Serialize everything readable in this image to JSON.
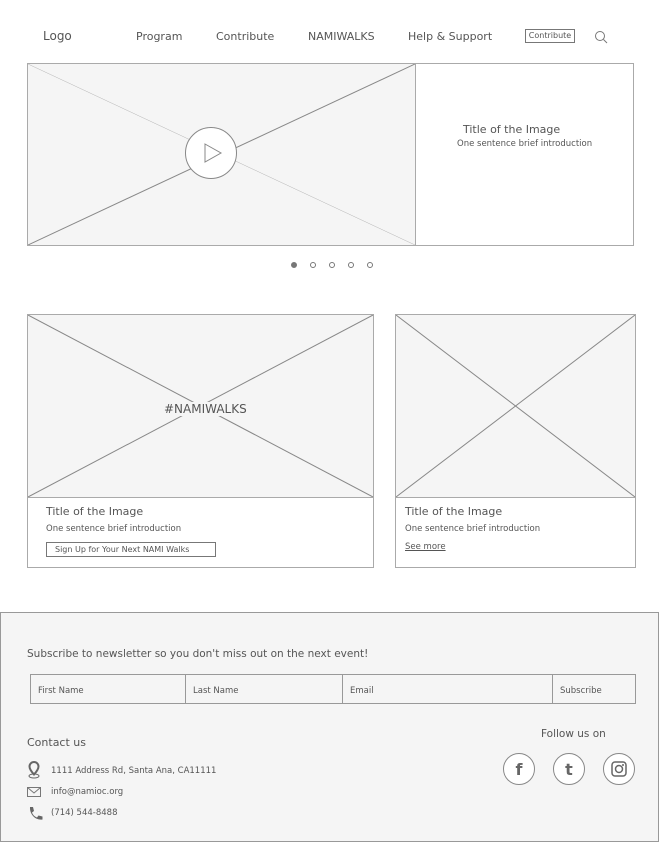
{
  "nav": {
    "logo": "Logo",
    "items": [
      "Program",
      "Contribute",
      "NAMIWALKS",
      "Help & Support"
    ],
    "cta": "Contribute"
  },
  "hero": {
    "title": "Title of the Image",
    "intro": "One sentence brief introduction",
    "slides": 5,
    "active_slide": 1
  },
  "cards": [
    {
      "overlay": "#NAMIWALKS",
      "title": "Title of the Image",
      "intro": "One sentence brief introduction",
      "button": "Sign Up for Your Next NAMI Walks"
    },
    {
      "title": "Title of the Image",
      "intro": "One sentence brief introduction",
      "link": "See more"
    }
  ],
  "footer": {
    "subscribe_text": "Subscribe to newsletter so you don't miss out on the next event!",
    "fields": {
      "first": "First Name",
      "last": "Last Name",
      "email": "Email"
    },
    "subscribe_button": "Subscribe",
    "contact_title": "Contact us",
    "address": "1111 Address Rd, Santa Ana, CA11111",
    "email": "info@namioc.org",
    "phone": "(714) 544-8488",
    "follow": "Follow us on",
    "social": {
      "facebook": "f",
      "tumblr": "t"
    }
  }
}
